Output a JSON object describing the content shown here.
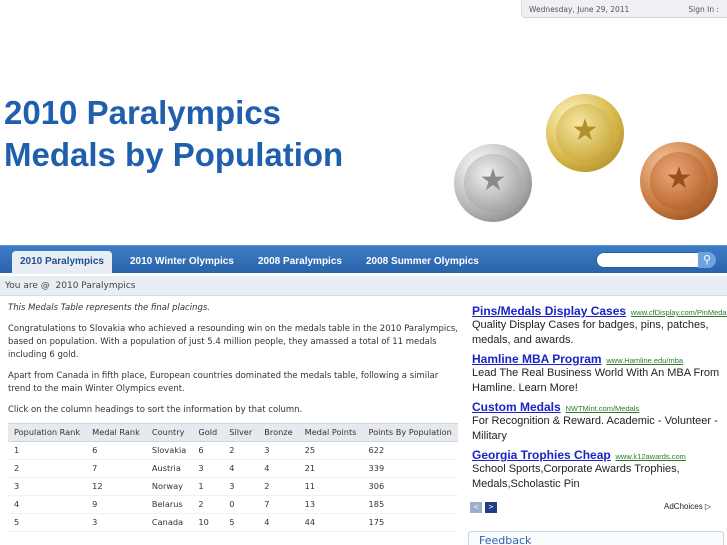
{
  "topbar": {
    "date": "Wednesday, June 29, 2011",
    "signin": "Sign In :"
  },
  "header": {
    "title_line1": "2010 Paralympics",
    "title_line2": "Medals by Population"
  },
  "medal_images": [
    "silver-medal",
    "gold-medal",
    "bronze-medal"
  ],
  "nav": {
    "tabs": [
      {
        "label": "2010 Paralympics",
        "active": true
      },
      {
        "label": "2010 Winter Olympics",
        "active": false
      },
      {
        "label": "2008 Paralympics",
        "active": false
      },
      {
        "label": "2008 Summer Olympics",
        "active": false
      }
    ],
    "search_placeholder": "",
    "search_icon": "magnifier-icon"
  },
  "breadcrumb": {
    "prefix": "You are @",
    "current": "2010 Paralympics"
  },
  "content": {
    "note": "This Medals Table represents the final placings.",
    "para1": "Congratulations to Slovakia who achieved a resounding win on the medals table in the 2010 Paralympics, based on population. With a population of just 5.4 million people, they amassed a total of 11 medals including 6 gold.",
    "para2": "Apart from Canada in fifth place, European countries dominated the medals table, following a similar trend to the main Winter Olympics event.",
    "sort_hint": "Click on the column headings to sort the information by that column."
  },
  "table": {
    "columns": [
      "Population Rank",
      "Medal Rank",
      "Country",
      "Gold",
      "Silver",
      "Bronze",
      "Medal Points",
      "Points By Population"
    ],
    "rows": [
      [
        "1",
        "6",
        "Slovakia",
        "6",
        "2",
        "3",
        "25",
        "622"
      ],
      [
        "2",
        "7",
        "Austria",
        "3",
        "4",
        "4",
        "21",
        "339"
      ],
      [
        "3",
        "12",
        "Norway",
        "1",
        "3",
        "2",
        "11",
        "306"
      ],
      [
        "4",
        "9",
        "Belarus",
        "2",
        "0",
        "7",
        "13",
        "185"
      ],
      [
        "5",
        "3",
        "Canada",
        "10",
        "5",
        "4",
        "44",
        "175"
      ]
    ]
  },
  "ads": [
    {
      "title": "Pins/Medals Display Cases",
      "url": "www.cfDisplay.com/PinMedalD",
      "desc": "Quality Display Cases for badges, pins, patches, medals, and awards."
    },
    {
      "title": "Hamline MBA Program",
      "url": "www.Hamline.edu/mba",
      "desc": "Lead The Real Business World With An MBA From Hamline. Learn More!"
    },
    {
      "title": "Custom Medals",
      "url": "NWTMint.com/Medals",
      "desc": "For Recognition & Reward. Academic - Volunteer - Military"
    },
    {
      "title": "Georgia Trophies Cheap",
      "url": "www.k12awards.com",
      "desc": "School Sports,Corporate Awards Trophies, Medals,Scholastic Pin"
    }
  ],
  "ad_nav": {
    "prev": "<",
    "next": ">"
  },
  "adchoices": "AdChoices ▷",
  "feedback": "Feedback",
  "colors": {
    "brand_blue": "#1f5fae",
    "nav_blue": "#2a64ab",
    "ad_link": "#1a23c7",
    "ad_url": "#2b7a2b"
  }
}
